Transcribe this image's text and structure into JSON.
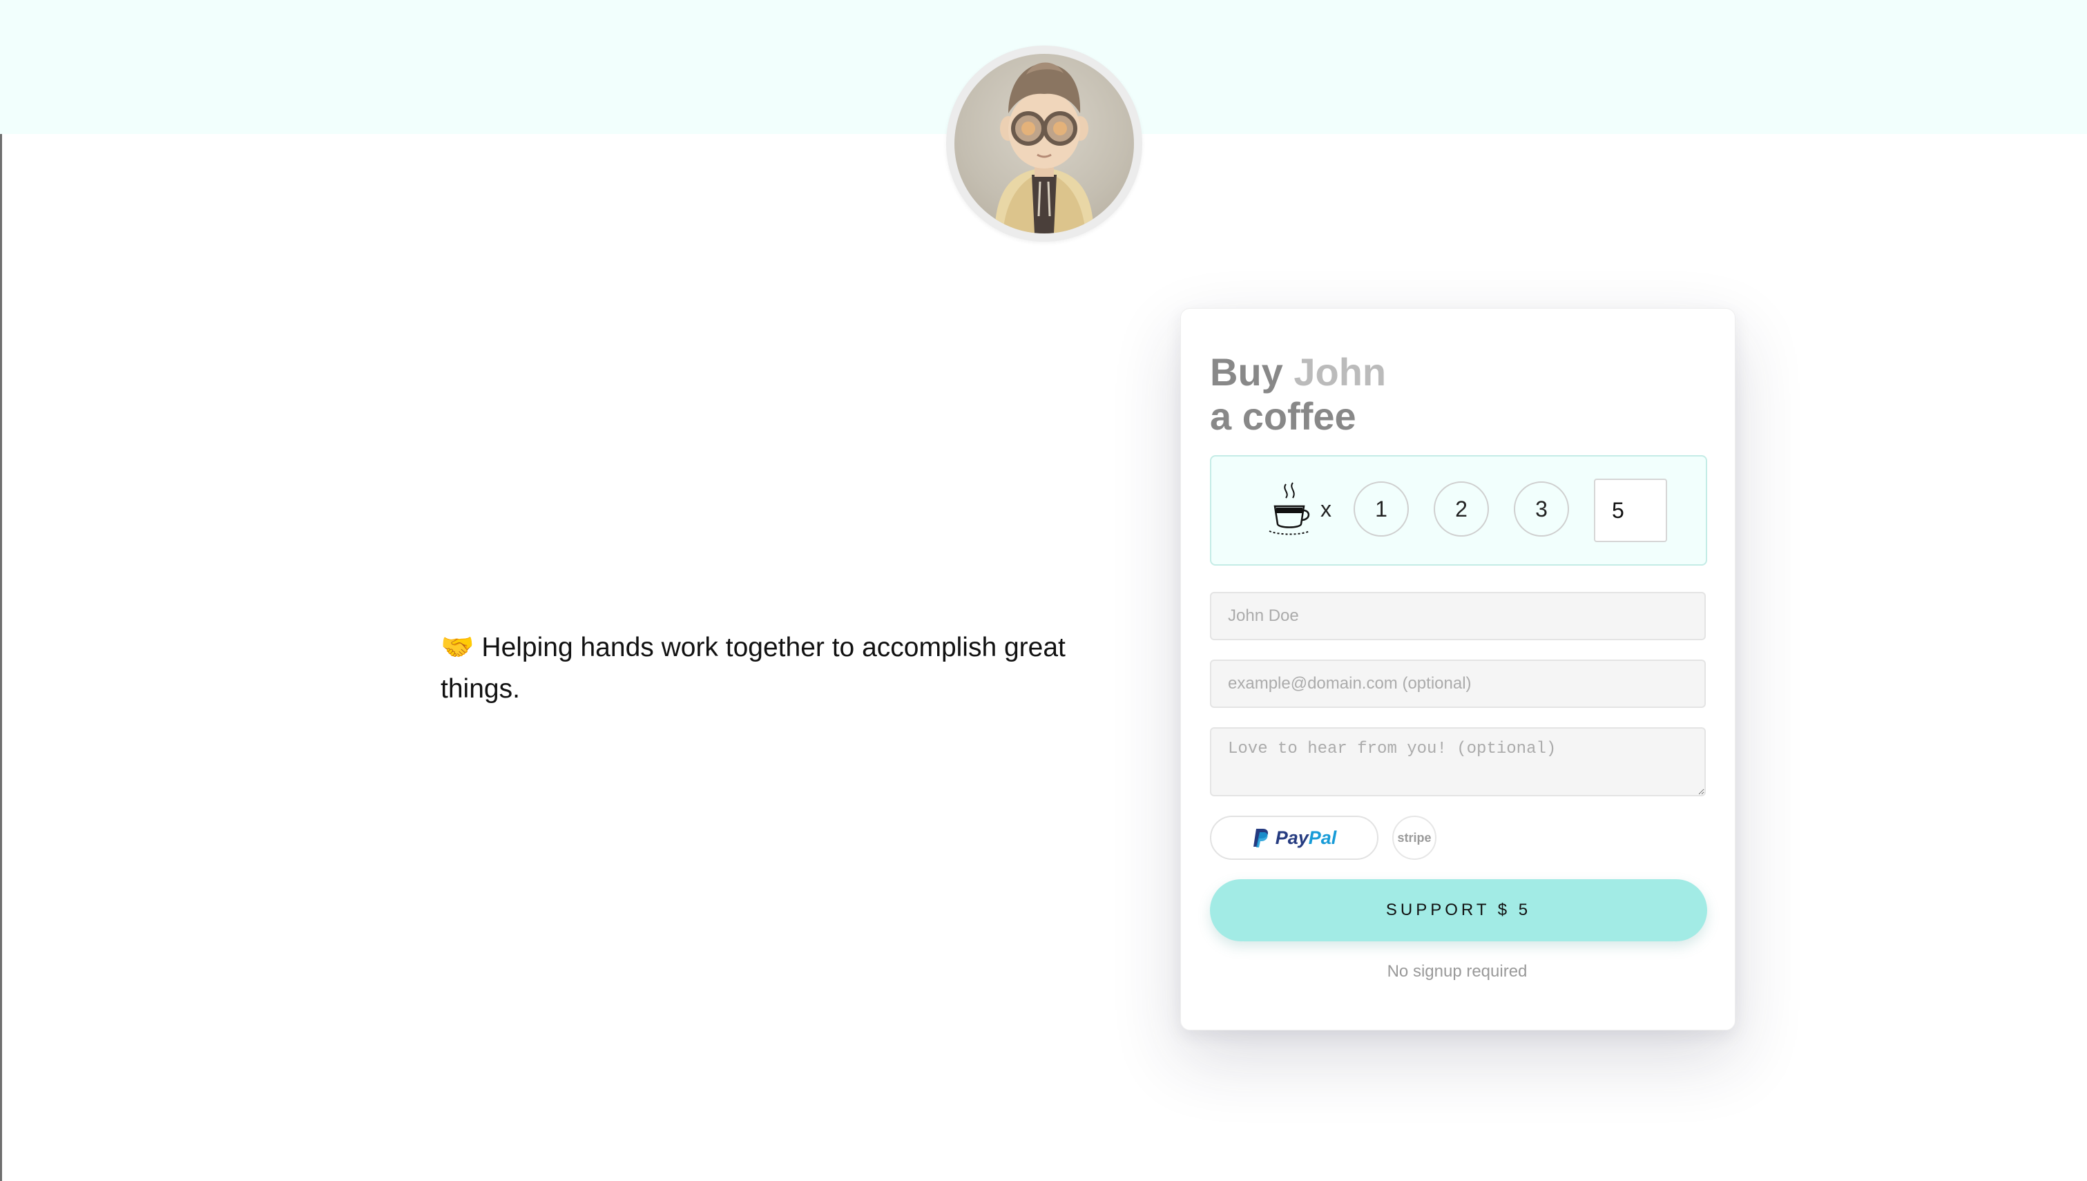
{
  "hero": {
    "avatar_alt": "avatar"
  },
  "tagline": {
    "emoji": "🤝",
    "text": "Helping hands work together to accomplish great things."
  },
  "card": {
    "title_prefix": "Buy",
    "title_name": "John",
    "title_suffix": "a coffee",
    "quantity": {
      "multiplier": "x",
      "options": [
        "1",
        "2",
        "3"
      ],
      "custom_value": "5"
    },
    "name_placeholder": "John Doe",
    "email_placeholder": "example@domain.com (optional)",
    "message_placeholder": "Love to hear from you! (optional)",
    "payment": {
      "paypal_part1": "Pay",
      "paypal_part2": "Pal",
      "stripe_label": "stripe"
    },
    "support_label": "SUPPORT $ 5",
    "footnote": "No signup required"
  },
  "colors": {
    "accent": "#a2ebe5",
    "hero_band": "#f2fffd",
    "paypal_dark": "#253b80",
    "paypal_light": "#179bd7"
  }
}
